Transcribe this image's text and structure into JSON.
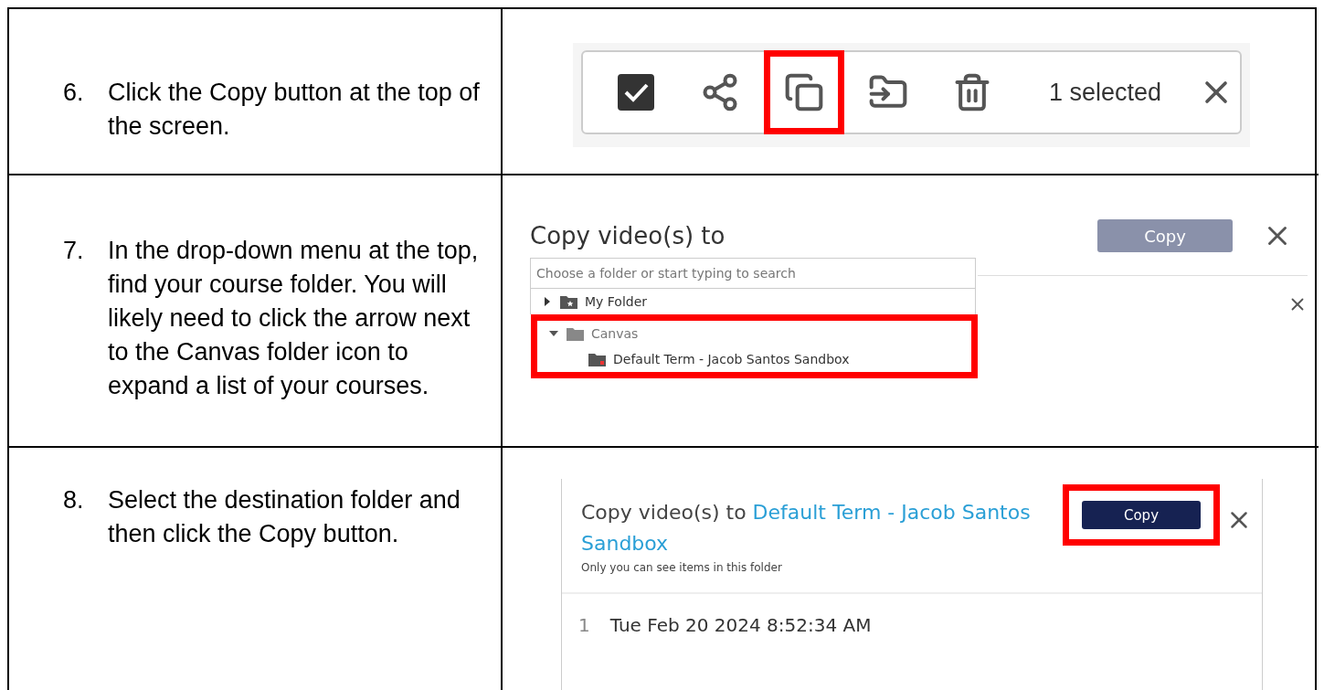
{
  "steps": [
    {
      "number": "6.",
      "text": "Click the Copy button at the top of the screen.",
      "kind": "toolbar",
      "screen": {
        "tools": [
          {
            "kind": "checkbox",
            "checked": true,
            "highlighted": false
          },
          {
            "kind": "share",
            "highlighted": false
          },
          {
            "kind": "copy",
            "highlighted": true
          },
          {
            "kind": "move",
            "highlighted": false
          },
          {
            "kind": "delete",
            "highlighted": false
          }
        ],
        "selection_label": "1 selected"
      }
    },
    {
      "number": "7.",
      "text": "In the drop-down menu at the top, find your course folder. You will likely need to click the arrow next to the Canvas folder icon to expand a list of your courses.",
      "kind": "picker",
      "screen": {
        "title": "Copy video(s) to",
        "button": {
          "label": "Copy",
          "disabled": true
        },
        "placeholder": "Choose a folder or start typing to search",
        "tree": [
          {
            "label": "My Folder",
            "kind": "starred",
            "expanded": false,
            "highlighted": false
          },
          {
            "label": "Canvas",
            "kind": "plain",
            "expanded": true,
            "highlighted": true,
            "children": [
              {
                "label": "Default Term - Jacob Santos Sandbox",
                "kind": "course"
              }
            ]
          }
        ]
      }
    },
    {
      "number": "8.",
      "text": "Select the destination folder and then click the Copy button.",
      "kind": "confirm",
      "screen": {
        "title": "Copy video(s) to",
        "destination": "Default Term - Jacob Santos Sandbox",
        "note": "Only you can see items in this folder",
        "button": {
          "label": "Copy",
          "disabled": false,
          "highlighted": true
        },
        "rows": [
          {
            "index": "1",
            "name": "Tue Feb 20 2024 8:52:34 AM"
          }
        ]
      }
    }
  ]
}
